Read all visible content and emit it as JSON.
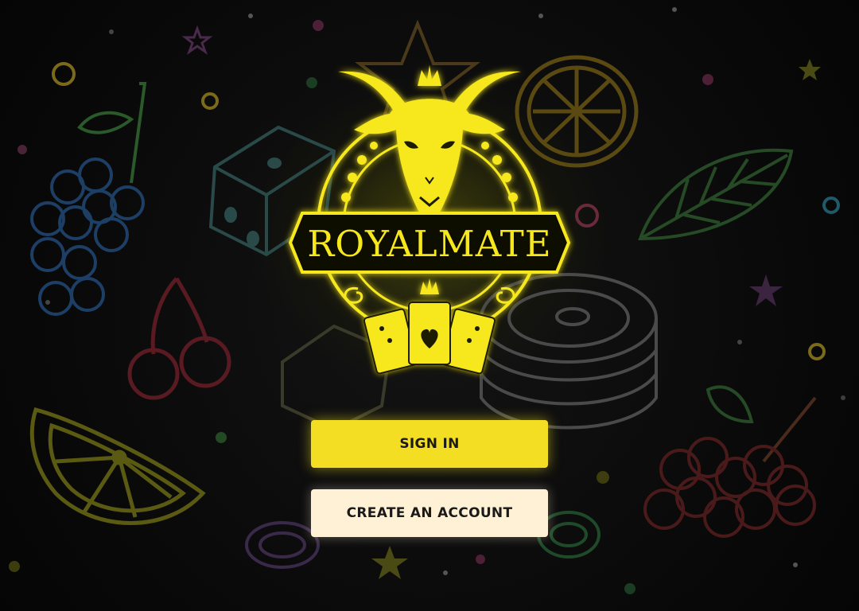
{
  "brand": {
    "name": "ROYALMATE"
  },
  "actions": {
    "sign_in": "SIGN IN",
    "create_account": "CREATE AN ACCOUNT"
  },
  "colors": {
    "accent": "#f3de23",
    "secondary_button": "#fff1d6",
    "background": "#0b0b0c"
  },
  "decorations": [
    "grapes-icon",
    "dice-icon",
    "lemon-icon",
    "leaf-icon",
    "cherries-icon",
    "casino-chip-icon",
    "star-icon",
    "card-icon"
  ]
}
